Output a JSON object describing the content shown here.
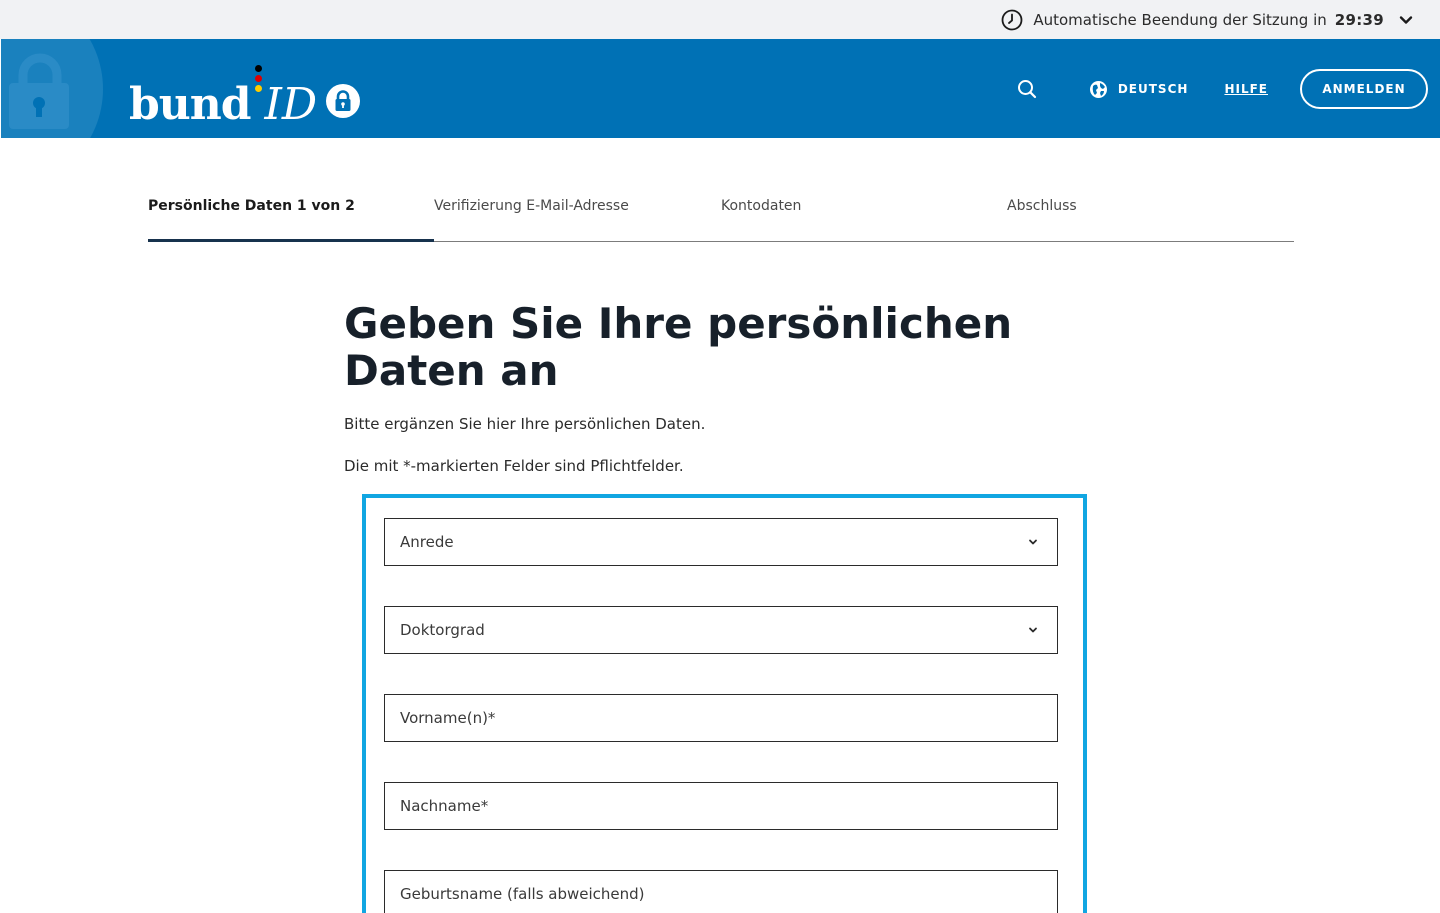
{
  "session": {
    "label": "Automatische Beendung der Sitzung in",
    "time": "29:39"
  },
  "header": {
    "logo_text_1": "bund",
    "logo_text_2": "ID",
    "language": "DEUTSCH",
    "help": "HILFE",
    "login": "ANMELDEN",
    "colors": {
      "brand": "#0071b5",
      "accent_box": "#11a6e2",
      "flag_black": "#000000",
      "flag_red": "#dd0000",
      "flag_gold": "#ffcc00"
    }
  },
  "icons": {
    "session": "clock-icon",
    "session_toggle": "chevron-down-icon",
    "search": "search-icon",
    "language": "globe-icon",
    "select": "chevron-down-icon"
  },
  "stepper": {
    "steps": [
      {
        "label": "Persönliche Daten 1 von 2",
        "active": true
      },
      {
        "label": "Verifizierung E-Mail-Adresse",
        "active": false
      },
      {
        "label": "Kontodaten",
        "active": false
      },
      {
        "label": "Abschluss",
        "active": false
      }
    ]
  },
  "main": {
    "title": "Geben Sie Ihre persönlichen Daten an",
    "intro": "Bitte ergänzen Sie hier Ihre persönlichen Daten.",
    "required_note": "Die mit *-markierten Felder sind Pflichtfelder."
  },
  "form": {
    "fields": [
      {
        "type": "select",
        "label": "Anrede"
      },
      {
        "type": "select",
        "label": "Doktorgrad"
      },
      {
        "type": "text",
        "label": "Vorname(n)*"
      },
      {
        "type": "text",
        "label": "Nachname*"
      },
      {
        "type": "text",
        "label": "Geburtsname (falls abweichend)"
      }
    ]
  }
}
